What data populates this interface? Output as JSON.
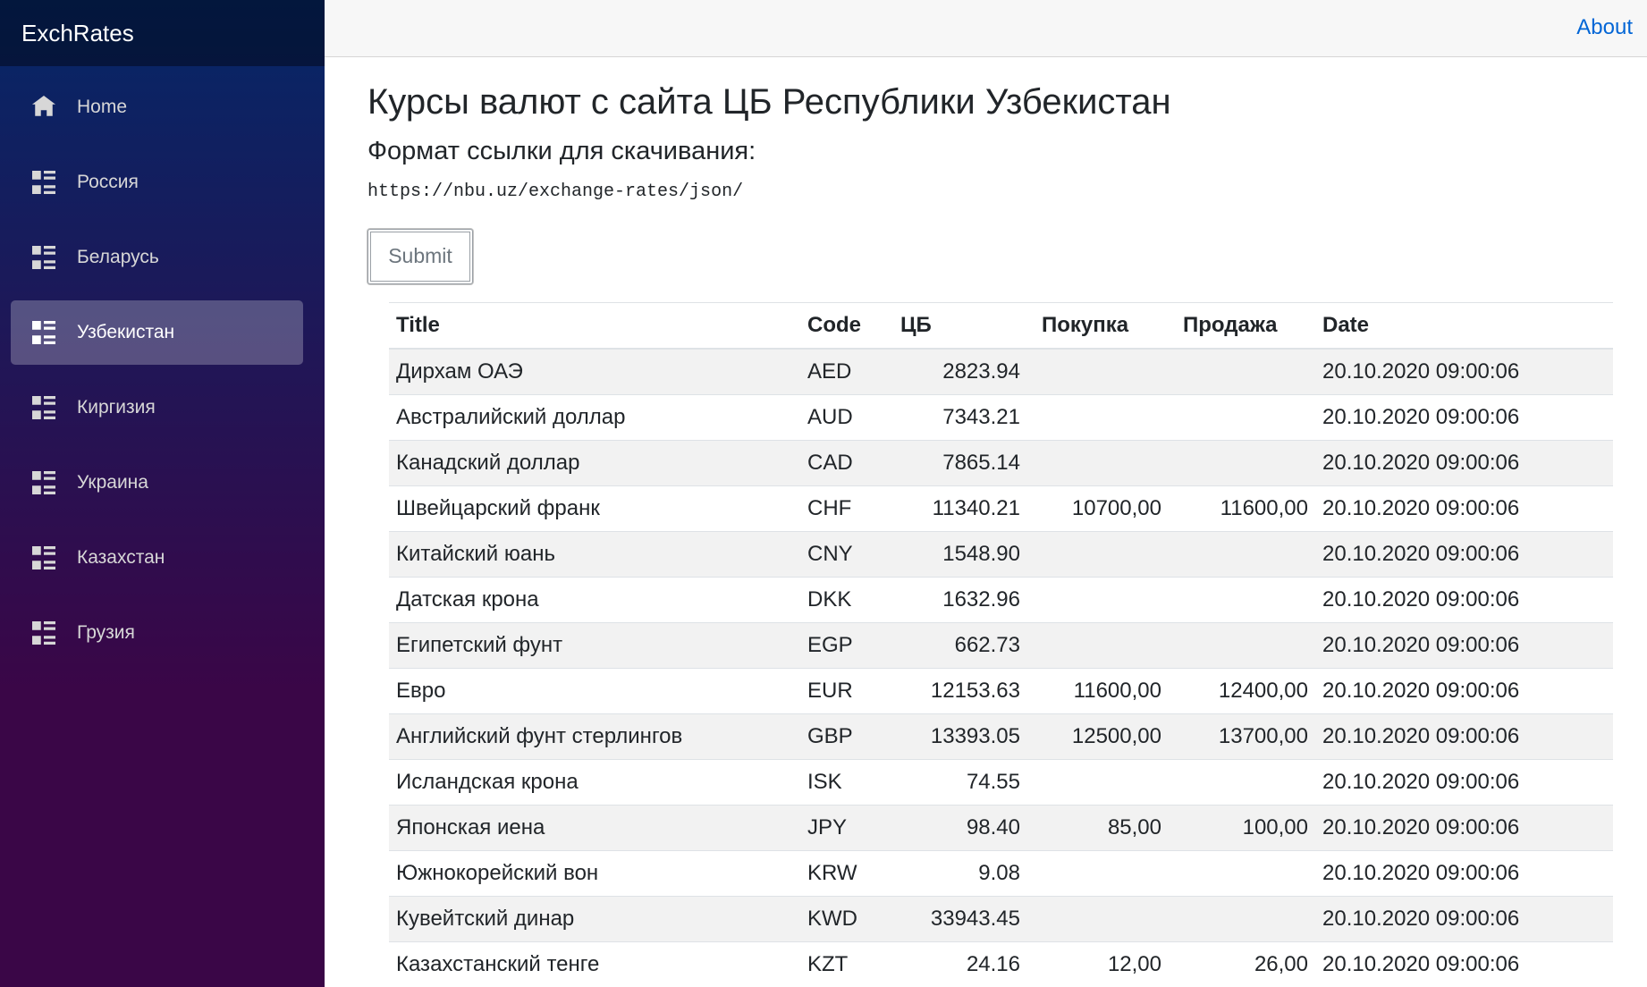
{
  "sidebar": {
    "brand": "ExchRates",
    "items": [
      {
        "label": "Home",
        "icon": "home-icon",
        "active": false
      },
      {
        "label": "Россия",
        "icon": "list-icon",
        "active": false
      },
      {
        "label": "Беларусь",
        "icon": "list-icon",
        "active": false
      },
      {
        "label": "Узбекистан",
        "icon": "list-icon",
        "active": true
      },
      {
        "label": "Киргизия",
        "icon": "list-icon",
        "active": false
      },
      {
        "label": "Украина",
        "icon": "list-icon",
        "active": false
      },
      {
        "label": "Казахстан",
        "icon": "list-icon",
        "active": false
      },
      {
        "label": "Грузия",
        "icon": "list-icon",
        "active": false
      }
    ]
  },
  "topbar": {
    "about": "About"
  },
  "main": {
    "title": "Курсы валют с сайта ЦБ Республики Узбекистан",
    "subtitle": "Формат ссылки для скачивания:",
    "url": "https://nbu.uz/exchange-rates/json/",
    "submit": "Submit"
  },
  "table": {
    "headers": [
      "Title",
      "Code",
      "ЦБ",
      "Покупка",
      "Продажа",
      "Date"
    ],
    "rows": [
      [
        "Дирхам ОАЭ",
        "AED",
        "2823.94",
        "",
        "",
        "20.10.2020 09:00:06"
      ],
      [
        "Австралийский доллар",
        "AUD",
        "7343.21",
        "",
        "",
        "20.10.2020 09:00:06"
      ],
      [
        "Канадский доллар",
        "CAD",
        "7865.14",
        "",
        "",
        "20.10.2020 09:00:06"
      ],
      [
        "Швейцарский франк",
        "CHF",
        "11340.21",
        "10700,00",
        "11600,00",
        "20.10.2020 09:00:06"
      ],
      [
        "Китайский юань",
        "CNY",
        "1548.90",
        "",
        "",
        "20.10.2020 09:00:06"
      ],
      [
        "Датская крона",
        "DKK",
        "1632.96",
        "",
        "",
        "20.10.2020 09:00:06"
      ],
      [
        "Египетский фунт",
        "EGP",
        "662.73",
        "",
        "",
        "20.10.2020 09:00:06"
      ],
      [
        "Евро",
        "EUR",
        "12153.63",
        "11600,00",
        "12400,00",
        "20.10.2020 09:00:06"
      ],
      [
        "Английский фунт стерлингов",
        "GBP",
        "13393.05",
        "12500,00",
        "13700,00",
        "20.10.2020 09:00:06"
      ],
      [
        "Исландская крона",
        "ISK",
        "74.55",
        "",
        "",
        "20.10.2020 09:00:06"
      ],
      [
        "Японская иена",
        "JPY",
        "98.40",
        "85,00",
        "100,00",
        "20.10.2020 09:00:06"
      ],
      [
        "Южнокорейский вон",
        "KRW",
        "9.08",
        "",
        "",
        "20.10.2020 09:00:06"
      ],
      [
        "Кувейтский динар",
        "KWD",
        "33943.45",
        "",
        "",
        "20.10.2020 09:00:06"
      ],
      [
        "Казахстанский тенге",
        "KZT",
        "24.16",
        "12,00",
        "26,00",
        "20.10.2020 09:00:06"
      ]
    ]
  },
  "colors": {
    "sidebar_top": "#052767",
    "sidebar_bottom": "#3a0647",
    "link": "#0366d6",
    "stripe": "#f2f2f2"
  }
}
